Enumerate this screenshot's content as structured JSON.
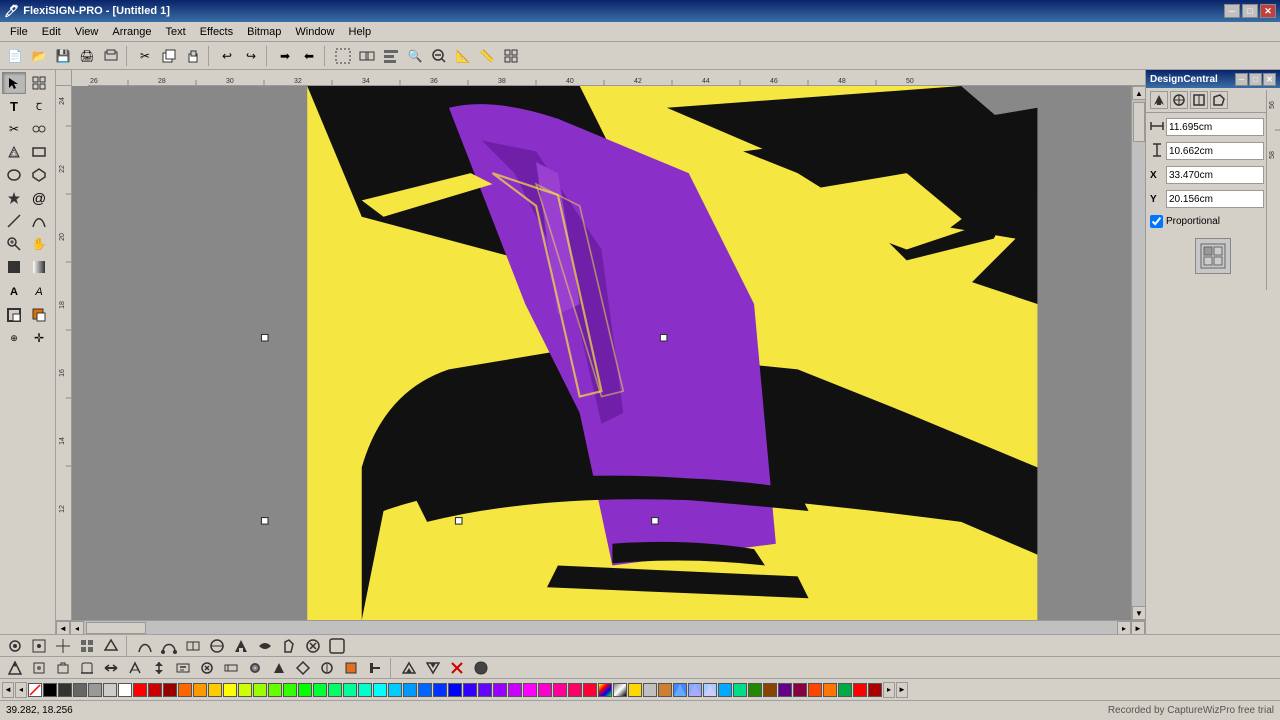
{
  "app": {
    "title": "FlexiSIGN-PRO - [Untitled 1]",
    "watermark": "Recorded by CaptureWizPro free trial"
  },
  "titlebar": {
    "title": "FlexiSIGN-PRO - [Untitled 1]",
    "minimize": "─",
    "restore": "□",
    "close": "✕"
  },
  "menubar": {
    "items": [
      "File",
      "Edit",
      "View",
      "Arrange",
      "Text",
      "Effects",
      "Bitmap",
      "Window",
      "Help"
    ]
  },
  "design_central": {
    "title": "DesignCentral",
    "width_label": "W",
    "height_label": "H",
    "x_label": "X",
    "y_label": "Y",
    "width_value": "11.695cm",
    "height_value": "10.662cm",
    "x_value": "33.470cm",
    "y_value": "20.156cm",
    "proportional_label": "Proportional",
    "proportional_checked": true
  },
  "status": {
    "coordinates": "39.282,  18.256",
    "watermark": "Recorded by CaptureWizPro free trial"
  },
  "colors": {
    "swatches": [
      "#000000",
      "#1a1a1a",
      "#333333",
      "#4d4d4d",
      "#666666",
      "#808080",
      "#999999",
      "#b3b3b3",
      "#cccccc",
      "#e6e6e6",
      "#ffffff",
      "#ff0000",
      "#cc0000",
      "#990000",
      "#ff6600",
      "#ff9900",
      "#ffcc00",
      "#ffff00",
      "#ccff00",
      "#99ff00",
      "#66ff00",
      "#33ff00",
      "#00ff00",
      "#00ff33",
      "#00ff66",
      "#00ff99",
      "#00ffcc",
      "#00ffff",
      "#00ccff",
      "#0099ff",
      "#0066ff",
      "#0033ff",
      "#0000ff",
      "#3300ff",
      "#6600ff",
      "#9900ff",
      "#cc00ff",
      "#ff00ff",
      "#ff00cc",
      "#ff0099",
      "#ff0066",
      "#ff0033",
      "#804000",
      "#008040",
      "#004080",
      "#400080",
      "#800040"
    ]
  },
  "ruler": {
    "h_marks": [
      "26",
      "28",
      "30",
      "32",
      "34",
      "36",
      "38",
      "40",
      "42",
      "44",
      "46",
      "48",
      "50"
    ],
    "v_marks": [
      "24",
      "22",
      "20",
      "18",
      "16",
      "14",
      "12"
    ],
    "right_marks": [
      "56",
      "58"
    ]
  },
  "tools": {
    "left": [
      {
        "id": "select",
        "icon": "↖",
        "label": "Select Tool"
      },
      {
        "id": "node",
        "icon": "⬡",
        "label": "Node Tool"
      },
      {
        "id": "text",
        "icon": "T",
        "label": "Text Tool"
      },
      {
        "id": "contour",
        "icon": "◈",
        "label": "Contour Tool"
      },
      {
        "id": "shape",
        "icon": "⬜",
        "label": "Shape Tool"
      },
      {
        "id": "ellipse",
        "icon": "⬭",
        "label": "Ellipse Tool"
      },
      {
        "id": "polygon",
        "icon": "⬠",
        "label": "Polygon Tool"
      },
      {
        "id": "star",
        "icon": "★",
        "label": "Star Tool"
      },
      {
        "id": "line",
        "icon": "╱",
        "label": "Line Tool"
      },
      {
        "id": "zoom",
        "icon": "🔍",
        "label": "Zoom Tool"
      },
      {
        "id": "fill",
        "icon": "⬛",
        "label": "Fill Tool"
      }
    ]
  },
  "toolbar_icons": [
    "📄",
    "📂",
    "💾",
    "🖨",
    "⬛",
    "✂",
    "📋",
    "📋",
    "↩",
    "↪",
    "➡",
    "⬅",
    "🔲",
    "🔳",
    "🔲",
    "🔎",
    "🔍",
    "📐",
    "📏",
    "✋"
  ]
}
